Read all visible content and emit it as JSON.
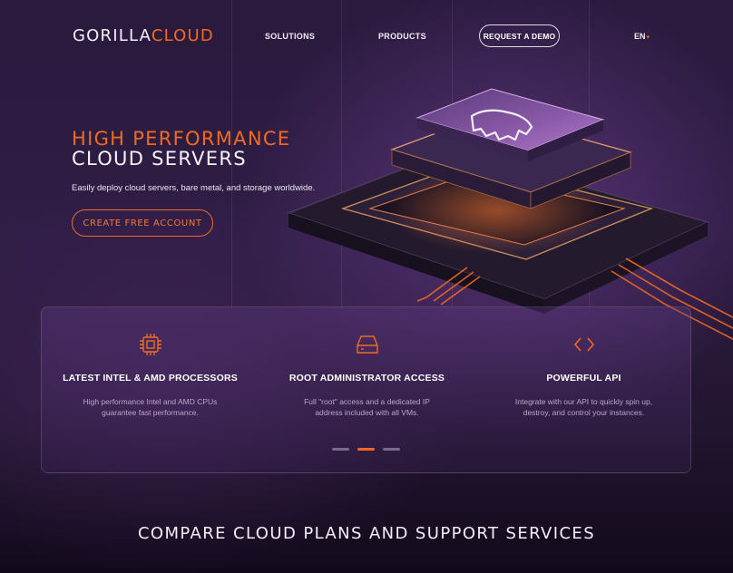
{
  "header": {
    "logo_part1": "GORILLA",
    "logo_part2": "CLOUD",
    "nav": [
      "SOLUTIONS",
      "PRODUCTS"
    ],
    "demo_label": "REQUEST A DEMO",
    "lang": "EN",
    "lang_caret": "▾"
  },
  "hero": {
    "title_line1": "HIGH PERFORMANCE",
    "title_line2": "CLOUD SERVERS",
    "subtitle": "Easily deploy cloud servers, bare metal, and storage worldwide.",
    "cta_label": "CREATE FREE ACCOUNT"
  },
  "features": [
    {
      "icon": "processor-chip-icon",
      "title": "LATEST INTEL & AMD PROCESSORS",
      "desc": "High performance Intel and AMD CPUs guarantee fast performance."
    },
    {
      "icon": "server-drive-icon",
      "title": "ROOT ADMINISTRATOR ACCESS",
      "desc": "Full \"root\" access and a dedicated IP address included with all VMs."
    },
    {
      "icon": "code-brackets-icon",
      "title": "POWERFUL API",
      "desc": "Integrate with our API to quickly spin up, destroy, and control your instances."
    }
  ],
  "carousel": {
    "count": 3,
    "active": 2
  },
  "compare_title": "COMPARE CLOUD PLANS AND SUPPORT SERVICES",
  "colors": {
    "accent": "#f26a21",
    "background": "#2a1a3d"
  }
}
